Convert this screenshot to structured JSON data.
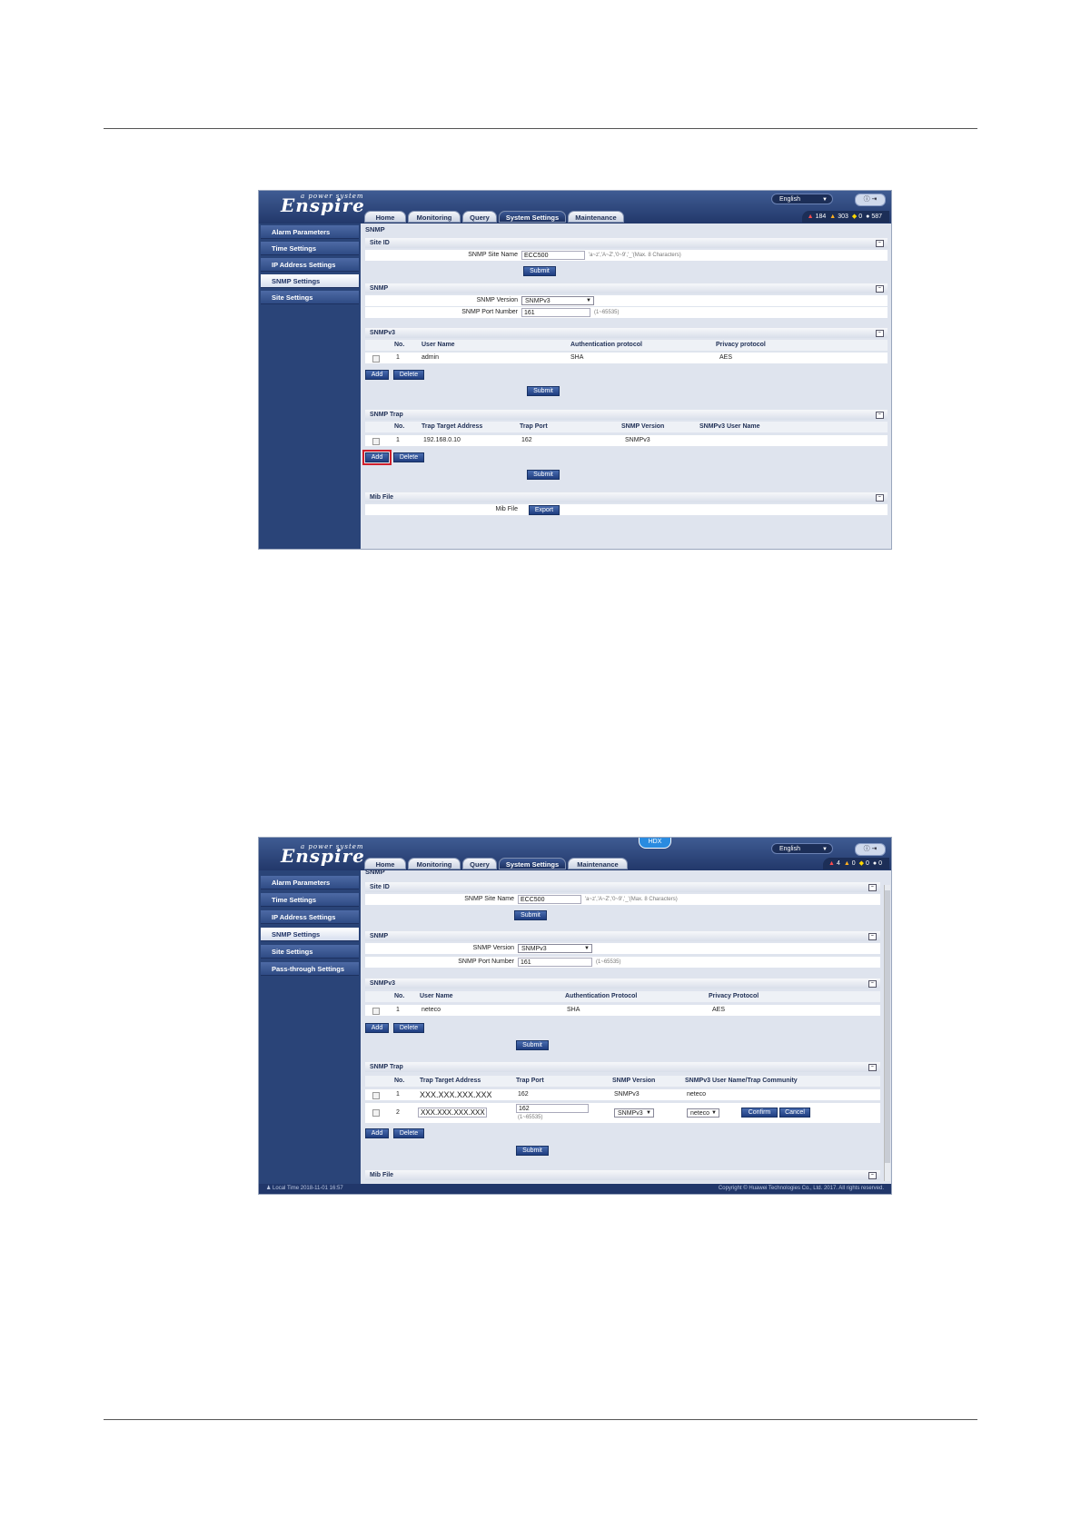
{
  "shot1": {
    "logo_text": "Enspire",
    "logo_tag": "a power system",
    "language": "English",
    "tabs": [
      "Home",
      "Monitoring",
      "Query",
      "System Settings",
      "Maintenance"
    ],
    "alarm_counts": [
      "184",
      "303",
      "0",
      "587"
    ],
    "sidebar": [
      "Alarm Parameters",
      "Time Settings",
      "IP Address Settings",
      "SNMP Settings",
      "Site Settings"
    ],
    "page_title": "SNMP",
    "site_id": {
      "title": "Site ID",
      "label": "SNMP Site Name",
      "value": "ECC500",
      "hint": "'a~z','A~Z','0~9','_'(Max. 8 Characters)",
      "submit": "Submit"
    },
    "snmp": {
      "title": "SNMP",
      "version_label": "SNMP Version",
      "version_value": "SNMPv3",
      "port_label": "SNMP Port Number",
      "port_value": "161",
      "port_hint": "(1~65535)"
    },
    "snmpv3": {
      "title": "SNMPv3",
      "headers": [
        "No.",
        "User Name",
        "Authentication protocol",
        "Privacy protocol"
      ],
      "rows": [
        [
          "1",
          "admin",
          "SHA",
          "AES"
        ]
      ],
      "add": "Add",
      "delete": "Delete",
      "submit": "Submit"
    },
    "trap": {
      "title": "SNMP Trap",
      "headers": [
        "No.",
        "Trap Target Address",
        "Trap Port",
        "SNMP Version",
        "SNMPv3 User Name"
      ],
      "rows": [
        [
          "1",
          "192.168.0.10",
          "162",
          "SNMPv3",
          ""
        ]
      ],
      "add": "Add",
      "delete": "Delete",
      "submit": "Submit"
    },
    "mib": {
      "title": "Mib File",
      "label": "Mib File",
      "export": "Export"
    }
  },
  "shot2": {
    "logo_text": "Enspire",
    "logo_tag": "a power system",
    "badge": "HDX",
    "language": "English",
    "tabs": [
      "Home",
      "Monitoring",
      "Query",
      "System Settings",
      "Maintenance"
    ],
    "alarm_counts": [
      "4",
      "0",
      "0",
      "0"
    ],
    "sidebar": [
      "Alarm Parameters",
      "Time Settings",
      "IP Address Settings",
      "SNMP Settings",
      "Site Settings",
      "Pass-through Settings"
    ],
    "page_title": "SNMP",
    "site_id": {
      "title": "Site ID",
      "label": "SNMP Site Name",
      "value": "ECC500",
      "hint": "'a~z','A~Z','0~9','_'(Max. 8 Characters)",
      "submit": "Submit"
    },
    "snmp": {
      "title": "SNMP",
      "version_label": "SNMP Version",
      "version_value": "SNMPv3",
      "port_label": "SNMP Port Number",
      "port_value": "161",
      "port_hint": "(1~65535)"
    },
    "snmpv3": {
      "title": "SNMPv3",
      "headers": [
        "No.",
        "User Name",
        "Authentication Protocol",
        "Privacy Protocol"
      ],
      "rows": [
        [
          "1",
          "neteco",
          "SHA",
          "AES"
        ]
      ],
      "add": "Add",
      "delete": "Delete",
      "submit": "Submit"
    },
    "trap": {
      "title": "SNMP Trap",
      "headers": [
        "No.",
        "Trap Target Address",
        "Trap Port",
        "SNMP Version",
        "SNMPv3 User Name/Trap Community"
      ],
      "row1": [
        "1",
        "XXX.XXX.XXX.XXX",
        "162",
        "SNMPv3",
        "neteco"
      ],
      "row2": {
        "no": "2",
        "address": "XXX.XXX.XXX.XXX",
        "port": "162",
        "port_hint": "(1~65535)",
        "version": "SNMPv3",
        "user": "neteco",
        "confirm": "Confirm",
        "cancel": "Cancel"
      },
      "add": "Add",
      "delete": "Delete",
      "submit": "Submit"
    },
    "mib_title": "Mib File",
    "footer_left": "Local Time   2018-11-01 16:57",
    "footer_right": "Copyright © Huawei Technologies Co., Ltd. 2017. All rights reserved."
  },
  "colors": {
    "header_dark": "#22386a",
    "sidebar": "#2a4478",
    "highlight": "#d0202c"
  }
}
